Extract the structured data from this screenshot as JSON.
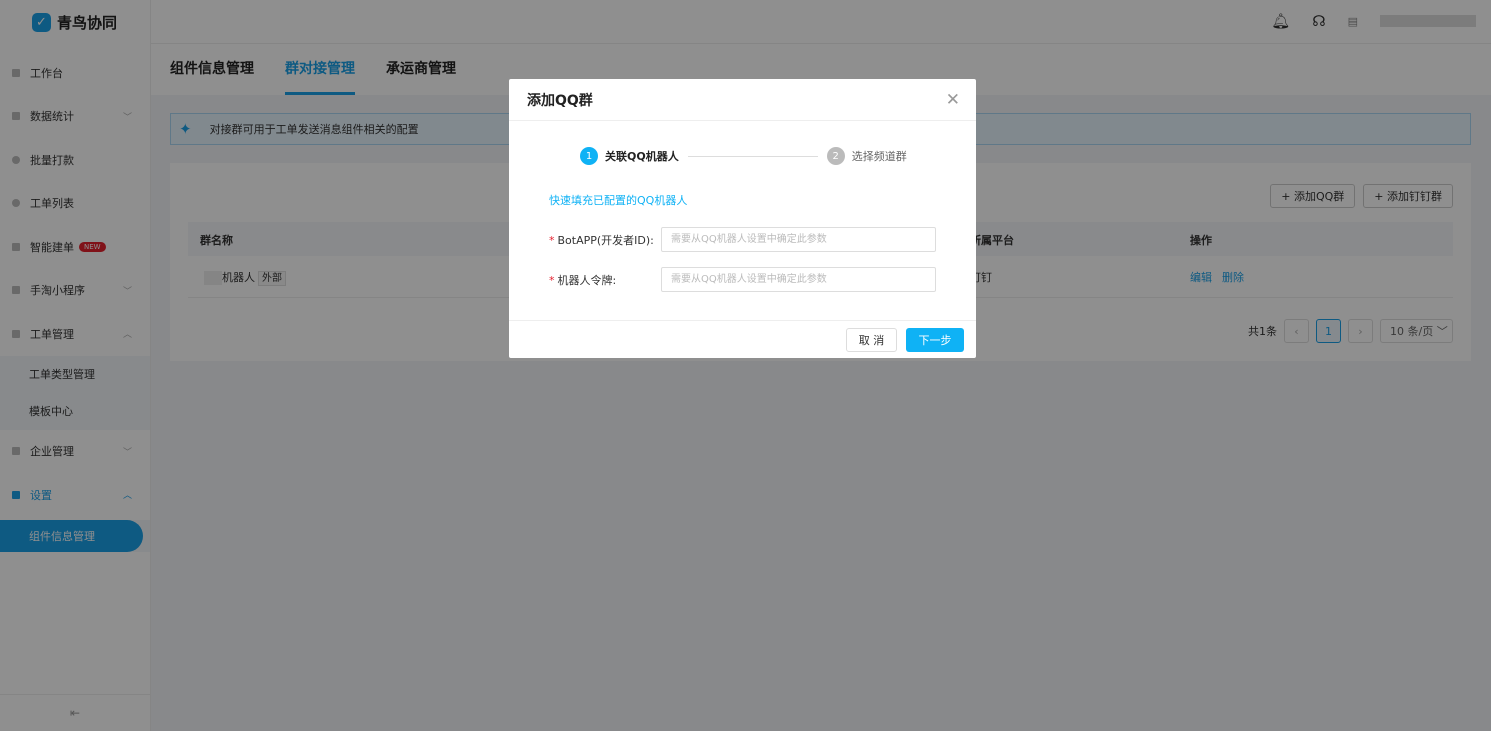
{
  "app": {
    "name": "青鸟协同"
  },
  "sidebar": {
    "items": [
      {
        "label": "工作台"
      },
      {
        "label": "数据统计",
        "chevron": "down"
      },
      {
        "label": "批量打款"
      },
      {
        "label": "工单列表"
      },
      {
        "label": "智能建单",
        "badge": "NEW"
      },
      {
        "label": "手淘小程序",
        "chevron": "down"
      },
      {
        "label": "工单管理",
        "chevron": "up"
      },
      {
        "label": "企业管理",
        "chevron": "down"
      },
      {
        "label": "设置",
        "chevron": "up"
      }
    ],
    "sub_ticket": [
      "工单类型管理",
      "模板中心"
    ],
    "sub_settings": [
      "组件信息管理"
    ]
  },
  "tabs": [
    "组件信息管理",
    "群对接管理",
    "承运商管理"
  ],
  "alert": "对接群可用于工单发送消息组件相关的配置",
  "buttons": {
    "add_qq": "+ 添加QQ群",
    "add_ding": "+ 添加钉钉群"
  },
  "table": {
    "headers": [
      "群名称",
      "所属平台",
      "操作"
    ],
    "rows": [
      {
        "name": "机器人",
        "tag": "外部",
        "platform": "钉钉",
        "actions": [
          "编辑",
          "删除"
        ]
      }
    ]
  },
  "pagination": {
    "total": "共1条",
    "current": "1",
    "size": "10 条/页"
  },
  "modal": {
    "title": "添加QQ群",
    "steps": [
      {
        "num": "1",
        "label": "关联QQ机器人"
      },
      {
        "num": "2",
        "label": "选择频道群"
      }
    ],
    "quick_fill": "快速填充已配置的QQ机器人",
    "fields": [
      {
        "label": "BotAPP(开发者ID):",
        "placeholder": "需要从QQ机器人设置中确定此参数"
      },
      {
        "label": "机器人令牌:",
        "placeholder": "需要从QQ机器人设置中确定此参数"
      }
    ],
    "cancel": "取 消",
    "next": "下一步"
  }
}
